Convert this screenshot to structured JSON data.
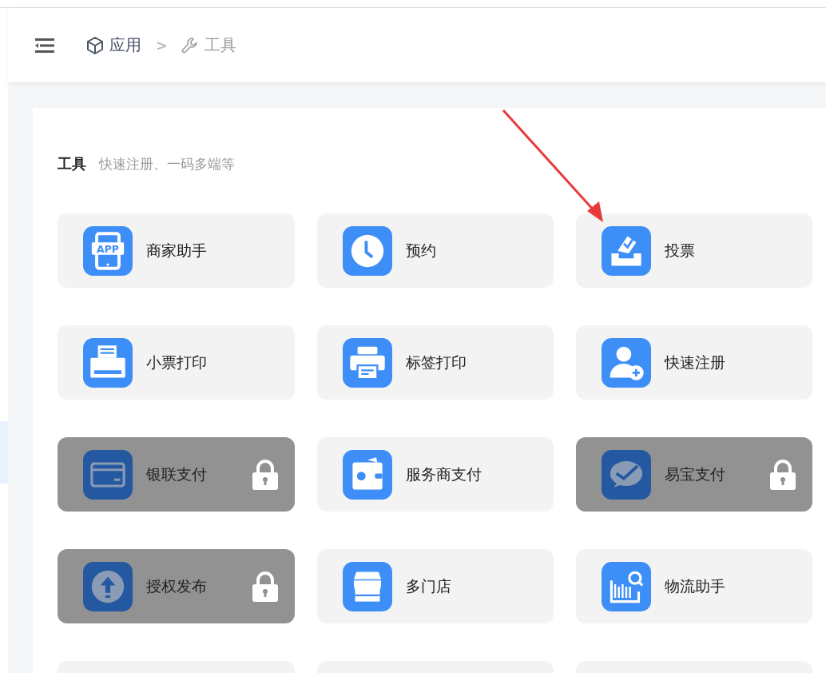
{
  "sidebar": {
    "items": [
      {
        "selected": true
      }
    ]
  },
  "breadcrumb": [
    {
      "label": "应用",
      "current": false
    },
    {
      "separator": ">"
    },
    {
      "label": "工具",
      "current": true
    }
  ],
  "section": {
    "title": "工具",
    "subtitle": "快速注册、一码多端等"
  },
  "tools": [
    {
      "label": "商家助手",
      "icon_text": "APP",
      "locked": false
    },
    {
      "label": "预约",
      "locked": false
    },
    {
      "label": "投票",
      "locked": false
    },
    {
      "label": "小票打印",
      "locked": false
    },
    {
      "label": "标签打印",
      "locked": false
    },
    {
      "label": "快速注册",
      "locked": false
    },
    {
      "label": "银联支付",
      "locked": true
    },
    {
      "label": "服务商支付",
      "locked": false
    },
    {
      "label": "易宝支付",
      "locked": true
    },
    {
      "label": "授权发布",
      "locked": true
    },
    {
      "label": "多门店",
      "locked": false
    },
    {
      "label": "物流助手",
      "locked": false
    },
    {
      "locked": false
    },
    {
      "locked": false
    },
    {
      "locked": false
    }
  ],
  "annotation": {
    "kind": "arrow"
  }
}
